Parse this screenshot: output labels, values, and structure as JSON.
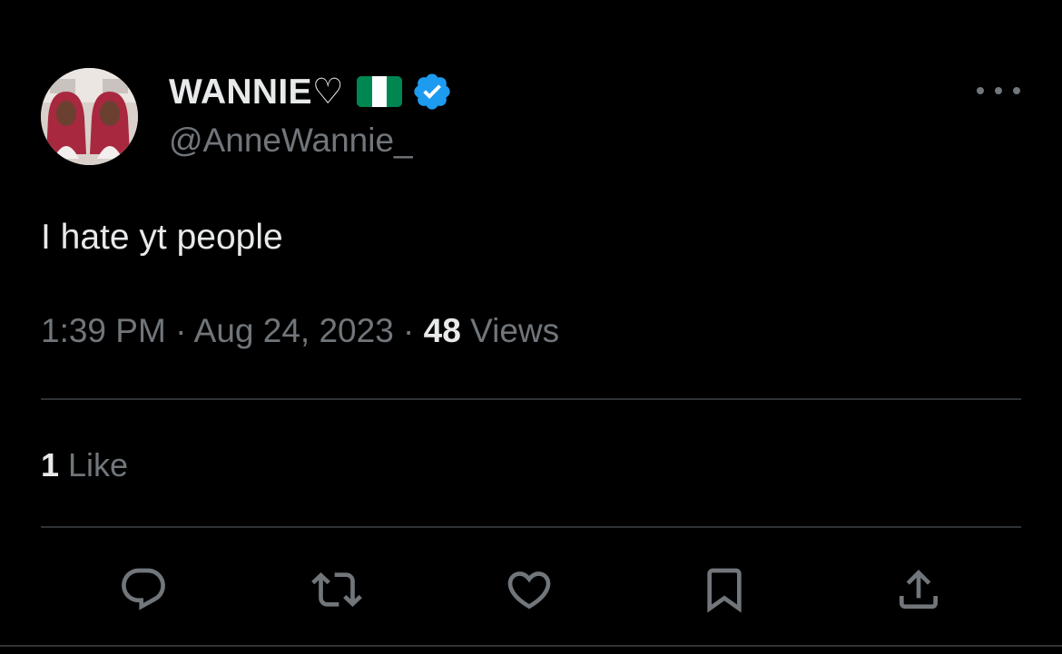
{
  "author": {
    "display_name": "WANNIE♡",
    "handle": "@AnneWannie_",
    "badges": [
      "nigeria-flag-icon",
      "verified-badge-icon"
    ]
  },
  "tweet": {
    "text": "I hate yt people"
  },
  "meta": {
    "time": "1:39 PM",
    "separator": " · ",
    "date": "Aug 24, 2023",
    "views_count": "48",
    "views_label": " Views"
  },
  "engagement": {
    "likes_count": "1",
    "likes_label": " Like"
  },
  "actions": [
    "reply-icon",
    "retweet-icon",
    "like-icon",
    "bookmark-icon",
    "share-icon"
  ],
  "colors": {
    "background": "#000000",
    "primary_text": "#e7e9ea",
    "secondary_text": "#71767b",
    "divider": "#2f3336",
    "verified_blue": "#1d9bf0",
    "flag_green": "#008751",
    "flag_white": "#ffffff"
  }
}
